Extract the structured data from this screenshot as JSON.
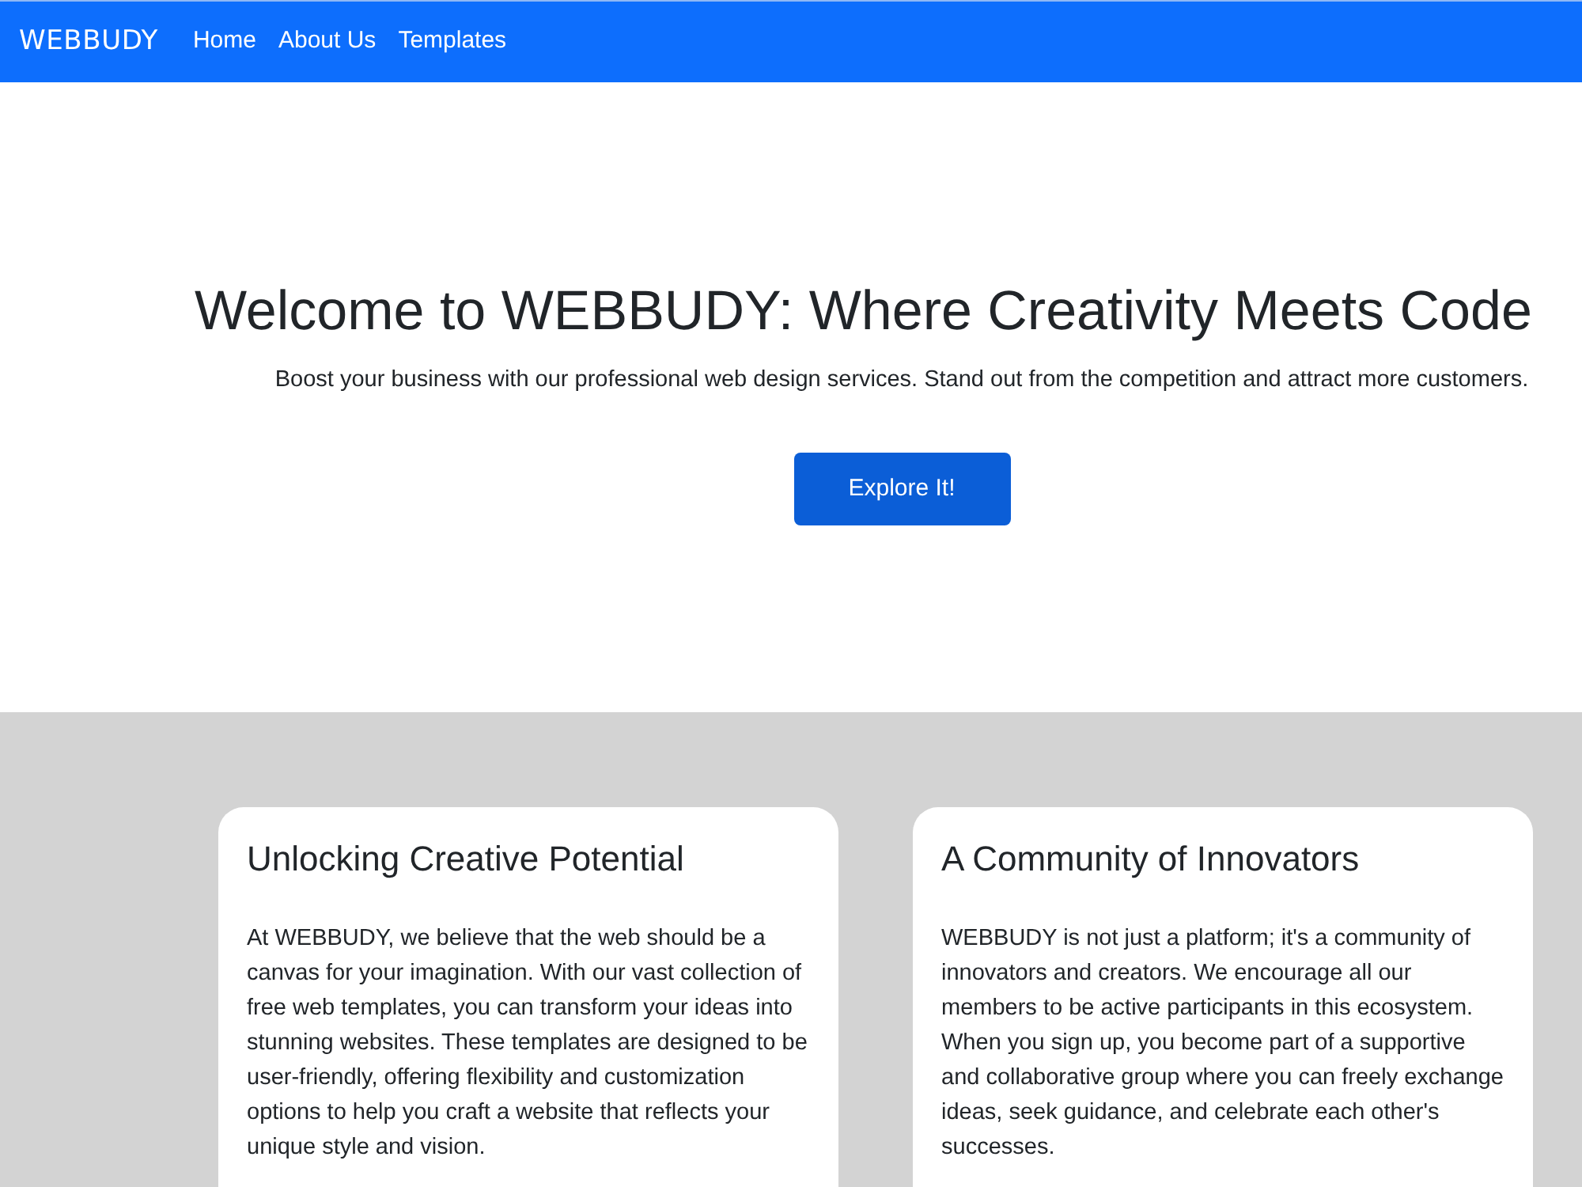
{
  "navbar": {
    "brand": "WEBBUDY",
    "links": [
      "Home",
      "About Us",
      "Templates"
    ]
  },
  "hero": {
    "title": "Welcome to WEBBUDY: Where Creativity Meets Code",
    "subtitle": "Boost your business with our professional web design services. Stand out from the competition and attract more customers.",
    "button": "Explore It!"
  },
  "cards": [
    {
      "title": "Unlocking Creative Potential",
      "body": "At WEBBUDY, we believe that the web should be a canvas for your imagination. With our vast collection of free web templates, you can transform your ideas into stunning websites. These templates are designed to be user-friendly, offering flexibility and customization options to help you craft a website that reflects your unique style and vision."
    },
    {
      "title": "A Community of Innovators",
      "body": "WEBBUDY is not just a platform; it's a community of innovators and creators. We encourage all our members to be active participants in this ecosystem. When you sign up, you become part of a supportive and collaborative group where you can freely exchange ideas, seek guidance, and celebrate each other's successes."
    }
  ]
}
